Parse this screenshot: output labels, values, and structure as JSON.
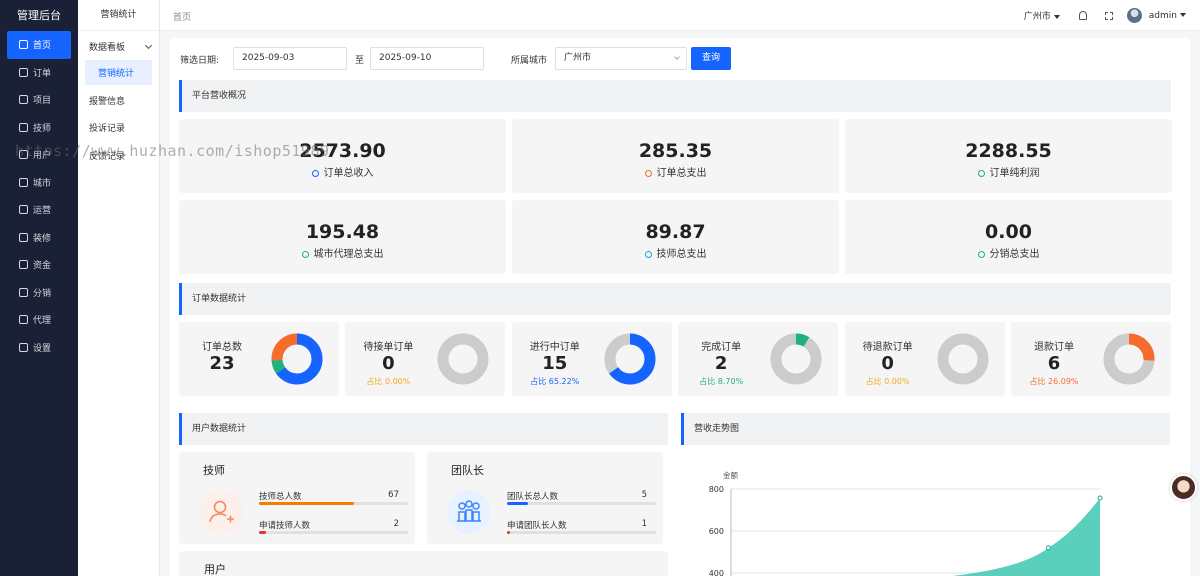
{
  "app": {
    "title": "管理后台"
  },
  "sidebar": {
    "items": [
      {
        "label": "首页",
        "icon": "home-icon",
        "active": true
      },
      {
        "label": "订单",
        "icon": "order-icon"
      },
      {
        "label": "项目",
        "icon": "project-icon"
      },
      {
        "label": "技师",
        "icon": "technician-icon"
      },
      {
        "label": "用户",
        "icon": "user-icon"
      },
      {
        "label": "城市",
        "icon": "city-chart-icon"
      },
      {
        "label": "运营",
        "icon": "operation-icon"
      },
      {
        "label": "装修",
        "icon": "decoration-icon"
      },
      {
        "label": "资金",
        "icon": "funds-icon"
      },
      {
        "label": "分销",
        "icon": "distribution-icon"
      },
      {
        "label": "代理",
        "icon": "agent-icon"
      },
      {
        "label": "设置",
        "icon": "settings-icon"
      }
    ]
  },
  "submenu": {
    "header": "营销统计",
    "group": "数据看板",
    "items": [
      {
        "label": "营销统计",
        "active": true
      },
      {
        "label": "报警信息"
      },
      {
        "label": "投诉记录"
      },
      {
        "label": "反馈记录"
      }
    ]
  },
  "topbar": {
    "breadcrumb": "首页",
    "city": "广州市",
    "username": "admin"
  },
  "filter": {
    "date_label": "筛选日期:",
    "start_date": "2025-09-03",
    "to_label": "至",
    "end_date": "2025-09-10",
    "city_label": "所属城市",
    "city_value": "广州市",
    "query_label": "查询"
  },
  "revenue": {
    "title": "平台营收概况",
    "stats": [
      {
        "value": "2573.90",
        "label": "订单总收入",
        "color": "#1664ff"
      },
      {
        "value": "285.35",
        "label": "订单总支出",
        "color": "#f56c2d"
      },
      {
        "value": "2288.55",
        "label": "订单纯利润",
        "color": "#1fb27c"
      },
      {
        "value": "195.48",
        "label": "城市代理总支出",
        "color": "#1fb27c"
      },
      {
        "value": "89.87",
        "label": "技师总支出",
        "color": "#1ea7d8"
      },
      {
        "value": "0.00",
        "label": "分销总支出",
        "color": "#1fb27c"
      }
    ]
  },
  "orders": {
    "title": "订单数据统计",
    "cards": [
      {
        "label": "订单总数",
        "value": "23",
        "pct_text": ""
      },
      {
        "label": "待接单订单",
        "value": "0",
        "pct_text": "占比 0.00%",
        "pct": 0,
        "color": "#f5a623"
      },
      {
        "label": "进行中订单",
        "value": "15",
        "pct_text": "占比 65.22%",
        "pct": 65.22,
        "color": "#1664ff"
      },
      {
        "label": "完成订单",
        "value": "2",
        "pct_text": "占比 8.70%",
        "pct": 8.7,
        "color": "#1fb27c"
      },
      {
        "label": "待退款订单",
        "value": "0",
        "pct_text": "占比 0.00%",
        "pct": 0,
        "color": "#f5a623"
      },
      {
        "label": "退款订单",
        "value": "6",
        "pct_text": "占比 26.09%",
        "pct": 26.09,
        "color": "#f56c2d"
      }
    ],
    "total_breakdown": [
      {
        "pct": 65.22,
        "color": "#1664ff"
      },
      {
        "pct": 8.7,
        "color": "#1fb27c"
      },
      {
        "pct": 26.09,
        "color": "#f56c2d"
      }
    ]
  },
  "users": {
    "title": "用户数据统计",
    "technician": {
      "title": "技师",
      "total_label": "技师总人数",
      "total": 67,
      "total_fraction": 0.64,
      "apply_label": "申请技师人数",
      "apply": 2,
      "apply_fraction": 0.05
    },
    "leader": {
      "title": "团队长",
      "total_label": "团队长总人数",
      "total": 5,
      "total_fraction": 0.14,
      "apply_label": "申请团队长人数",
      "apply": 1,
      "apply_fraction": 0.02
    },
    "user": {
      "title": "用户"
    }
  },
  "trend": {
    "title": "营收走势图"
  },
  "chart_data": {
    "type": "area",
    "ylabel": "金额",
    "yticks": [
      "800",
      "600",
      "400"
    ],
    "ylim": [
      0,
      800
    ],
    "x": [
      0.925,
      1.0
    ],
    "points": [
      {
        "x": 0.6,
        "y": 0
      },
      {
        "x": 0.86,
        "y": 520
      },
      {
        "x": 1.0,
        "y": 757
      }
    ],
    "color": "#3cc7b0"
  },
  "watermark": "https://www.huzhan.com/ishop51989"
}
